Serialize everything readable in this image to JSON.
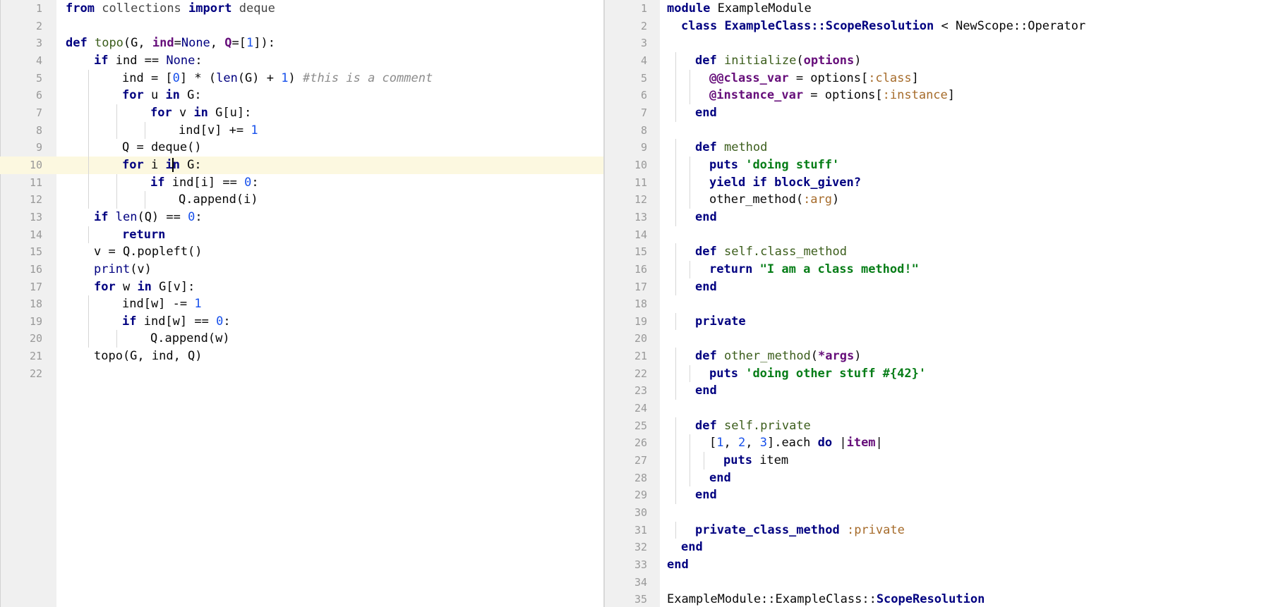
{
  "left_editor": {
    "language": "python",
    "current_line": 10,
    "lines": [
      {
        "n": "1",
        "indent": 0,
        "tokens": [
          [
            "k",
            "from"
          ],
          [
            "p",
            " "
          ],
          [
            "f",
            "collections"
          ],
          [
            "p",
            " "
          ],
          [
            "k",
            "import"
          ],
          [
            "p",
            " "
          ],
          [
            "f",
            "deque"
          ]
        ]
      },
      {
        "n": "2",
        "indent": 0,
        "tokens": []
      },
      {
        "n": "3",
        "indent": 0,
        "tokens": [
          [
            "k",
            "def"
          ],
          [
            "p",
            " "
          ],
          [
            "fn",
            "topo"
          ],
          [
            "p",
            "(G, "
          ],
          [
            "iv",
            "ind"
          ],
          [
            "p",
            "="
          ],
          [
            "bi",
            "None"
          ],
          [
            "p",
            ", "
          ],
          [
            "iv",
            "Q"
          ],
          [
            "p",
            "=["
          ],
          [
            "n",
            "1"
          ],
          [
            "p",
            "]):"
          ]
        ]
      },
      {
        "n": "4",
        "indent": 1,
        "tokens": [
          [
            "k",
            "if"
          ],
          [
            "p",
            " ind == "
          ],
          [
            "bi",
            "None"
          ],
          [
            "p",
            ":"
          ]
        ]
      },
      {
        "n": "5",
        "indent": 2,
        "tokens": [
          [
            "p",
            "ind = ["
          ],
          [
            "n",
            "0"
          ],
          [
            "p",
            "] * ("
          ],
          [
            "bi",
            "len"
          ],
          [
            "p",
            "(G) + "
          ],
          [
            "n",
            "1"
          ],
          [
            "p",
            ") "
          ],
          [
            "c",
            "#this is a comment"
          ]
        ]
      },
      {
        "n": "6",
        "indent": 2,
        "tokens": [
          [
            "k",
            "for"
          ],
          [
            "p",
            " u "
          ],
          [
            "k",
            "in"
          ],
          [
            "p",
            " G:"
          ]
        ]
      },
      {
        "n": "7",
        "indent": 3,
        "tokens": [
          [
            "k",
            "for"
          ],
          [
            "p",
            " v "
          ],
          [
            "k",
            "in"
          ],
          [
            "p",
            " G[u]:"
          ]
        ]
      },
      {
        "n": "8",
        "indent": 4,
        "tokens": [
          [
            "p",
            "ind[v] += "
          ],
          [
            "n",
            "1"
          ]
        ]
      },
      {
        "n": "9",
        "indent": 2,
        "tokens": [
          [
            "p",
            "Q = deque()"
          ]
        ]
      },
      {
        "n": "10",
        "indent": 2,
        "tokens": [
          [
            "k",
            "for"
          ],
          [
            "p",
            " i "
          ],
          [
            "k",
            "i"
          ],
          [
            "cursor",
            ""
          ],
          [
            "k",
            "n"
          ],
          [
            "p",
            " G:"
          ]
        ]
      },
      {
        "n": "11",
        "indent": 3,
        "tokens": [
          [
            "k",
            "if"
          ],
          [
            "p",
            " ind[i] == "
          ],
          [
            "n",
            "0"
          ],
          [
            "p",
            ":"
          ]
        ]
      },
      {
        "n": "12",
        "indent": 4,
        "tokens": [
          [
            "p",
            "Q.append(i)"
          ]
        ]
      },
      {
        "n": "13",
        "indent": 1,
        "tokens": [
          [
            "k",
            "if"
          ],
          [
            "p",
            " "
          ],
          [
            "bi",
            "len"
          ],
          [
            "p",
            "(Q) == "
          ],
          [
            "n",
            "0"
          ],
          [
            "p",
            ":"
          ]
        ]
      },
      {
        "n": "14",
        "indent": 2,
        "tokens": [
          [
            "k",
            "return"
          ]
        ]
      },
      {
        "n": "15",
        "indent": 1,
        "tokens": [
          [
            "p",
            "v = Q.popleft()"
          ]
        ]
      },
      {
        "n": "16",
        "indent": 1,
        "tokens": [
          [
            "bi",
            "print"
          ],
          [
            "p",
            "(v)"
          ]
        ]
      },
      {
        "n": "17",
        "indent": 1,
        "tokens": [
          [
            "k",
            "for"
          ],
          [
            "p",
            " w "
          ],
          [
            "k",
            "in"
          ],
          [
            "p",
            " G[v]:"
          ]
        ]
      },
      {
        "n": "18",
        "indent": 2,
        "tokens": [
          [
            "p",
            "ind[w] -= "
          ],
          [
            "n",
            "1"
          ]
        ]
      },
      {
        "n": "19",
        "indent": 2,
        "tokens": [
          [
            "k",
            "if"
          ],
          [
            "p",
            " ind[w] == "
          ],
          [
            "n",
            "0"
          ],
          [
            "p",
            ":"
          ]
        ]
      },
      {
        "n": "20",
        "indent": 3,
        "tokens": [
          [
            "p",
            "Q.append(w)"
          ]
        ]
      },
      {
        "n": "21",
        "indent": 1,
        "tokens": [
          [
            "p",
            "topo(G, ind, Q)"
          ]
        ]
      },
      {
        "n": "22",
        "indent": 0,
        "tokens": []
      }
    ]
  },
  "right_editor": {
    "language": "ruby",
    "lines": [
      {
        "n": "1",
        "indent": 0,
        "tokens": [
          [
            "k",
            "module"
          ],
          [
            "p",
            " ExampleModule"
          ]
        ]
      },
      {
        "n": "2",
        "indent": 1,
        "tokens": [
          [
            "k",
            "class"
          ],
          [
            "p",
            " "
          ],
          [
            "nm",
            "ExampleClass::ScopeResolution"
          ],
          [
            "p",
            " < NewScope::Operator"
          ]
        ]
      },
      {
        "n": "3",
        "indent": 0,
        "tokens": []
      },
      {
        "n": "4",
        "indent": 2,
        "tokens": [
          [
            "k",
            "def"
          ],
          [
            "p",
            " "
          ],
          [
            "rm",
            "initialize"
          ],
          [
            "p",
            "("
          ],
          [
            "iv",
            "options"
          ],
          [
            "p",
            ")"
          ]
        ]
      },
      {
        "n": "5",
        "indent": 3,
        "tokens": [
          [
            "iv",
            "@@class_var"
          ],
          [
            "p",
            " = options["
          ],
          [
            "sym",
            ":class"
          ],
          [
            "p",
            "]"
          ]
        ]
      },
      {
        "n": "6",
        "indent": 3,
        "tokens": [
          [
            "iv",
            "@instance_var"
          ],
          [
            "p",
            " = options["
          ],
          [
            "sym",
            ":instance"
          ],
          [
            "p",
            "]"
          ]
        ]
      },
      {
        "n": "7",
        "indent": 2,
        "tokens": [
          [
            "k",
            "end"
          ]
        ]
      },
      {
        "n": "8",
        "indent": 0,
        "tokens": []
      },
      {
        "n": "9",
        "indent": 2,
        "tokens": [
          [
            "k",
            "def"
          ],
          [
            "p",
            " "
          ],
          [
            "rm",
            "method"
          ]
        ]
      },
      {
        "n": "10",
        "indent": 3,
        "tokens": [
          [
            "k",
            "puts"
          ],
          [
            "p",
            " "
          ],
          [
            "s",
            "'doing stuff'"
          ]
        ]
      },
      {
        "n": "11",
        "indent": 3,
        "tokens": [
          [
            "k",
            "yield"
          ],
          [
            "p",
            " "
          ],
          [
            "k",
            "if"
          ],
          [
            "p",
            " "
          ],
          [
            "k",
            "block_given?"
          ]
        ]
      },
      {
        "n": "12",
        "indent": 3,
        "tokens": [
          [
            "p",
            "other_method("
          ],
          [
            "sym",
            ":arg"
          ],
          [
            "p",
            ")"
          ]
        ]
      },
      {
        "n": "13",
        "indent": 2,
        "tokens": [
          [
            "k",
            "end"
          ]
        ]
      },
      {
        "n": "14",
        "indent": 0,
        "tokens": []
      },
      {
        "n": "15",
        "indent": 2,
        "tokens": [
          [
            "k",
            "def"
          ],
          [
            "p",
            " "
          ],
          [
            "rm",
            "self.class_method"
          ]
        ]
      },
      {
        "n": "16",
        "indent": 3,
        "tokens": [
          [
            "k",
            "return"
          ],
          [
            "p",
            " "
          ],
          [
            "s",
            "\"I am a class method!\""
          ]
        ]
      },
      {
        "n": "17",
        "indent": 2,
        "tokens": [
          [
            "k",
            "end"
          ]
        ]
      },
      {
        "n": "18",
        "indent": 0,
        "tokens": []
      },
      {
        "n": "19",
        "indent": 2,
        "tokens": [
          [
            "k",
            "private"
          ]
        ]
      },
      {
        "n": "20",
        "indent": 0,
        "tokens": []
      },
      {
        "n": "21",
        "indent": 2,
        "tokens": [
          [
            "k",
            "def"
          ],
          [
            "p",
            " "
          ],
          [
            "rm",
            "other_method"
          ],
          [
            "p",
            "("
          ],
          [
            "iv",
            "*args"
          ],
          [
            "p",
            ")"
          ]
        ]
      },
      {
        "n": "22",
        "indent": 3,
        "tokens": [
          [
            "k",
            "puts"
          ],
          [
            "p",
            " "
          ],
          [
            "s",
            "'doing other stuff #{42}'"
          ]
        ]
      },
      {
        "n": "23",
        "indent": 2,
        "tokens": [
          [
            "k",
            "end"
          ]
        ]
      },
      {
        "n": "24",
        "indent": 0,
        "tokens": []
      },
      {
        "n": "25",
        "indent": 2,
        "tokens": [
          [
            "k",
            "def"
          ],
          [
            "p",
            " "
          ],
          [
            "rm",
            "self.private"
          ]
        ]
      },
      {
        "n": "26",
        "indent": 3,
        "tokens": [
          [
            "p",
            "["
          ],
          [
            "n",
            "1"
          ],
          [
            "p",
            ", "
          ],
          [
            "n",
            "2"
          ],
          [
            "p",
            ", "
          ],
          [
            "n",
            "3"
          ],
          [
            "p",
            "].each "
          ],
          [
            "k",
            "do"
          ],
          [
            "p",
            " |"
          ],
          [
            "iv",
            "item"
          ],
          [
            "p",
            "|"
          ]
        ]
      },
      {
        "n": "27",
        "indent": 4,
        "tokens": [
          [
            "k",
            "puts"
          ],
          [
            "p",
            " item"
          ]
        ]
      },
      {
        "n": "28",
        "indent": 3,
        "tokens": [
          [
            "k",
            "end"
          ]
        ]
      },
      {
        "n": "29",
        "indent": 2,
        "tokens": [
          [
            "k",
            "end"
          ]
        ]
      },
      {
        "n": "30",
        "indent": 0,
        "tokens": []
      },
      {
        "n": "31",
        "indent": 2,
        "tokens": [
          [
            "k",
            "private_class_method"
          ],
          [
            "p",
            " "
          ],
          [
            "sym",
            ":private"
          ]
        ]
      },
      {
        "n": "32",
        "indent": 1,
        "tokens": [
          [
            "k",
            "end"
          ]
        ]
      },
      {
        "n": "33",
        "indent": 0,
        "tokens": [
          [
            "k",
            "end"
          ]
        ]
      },
      {
        "n": "34",
        "indent": 0,
        "tokens": []
      },
      {
        "n": "35",
        "indent": 0,
        "tokens": [
          [
            "p",
            "ExampleModule::ExampleClass::"
          ],
          [
            "nm",
            "ScopeResolution"
          ]
        ]
      }
    ]
  },
  "colors": {
    "keyword": "#000080",
    "number": "#1750eb",
    "string": "#067d17",
    "symbol": "#a66b2a",
    "comment": "#8c8c8c",
    "current_line": "#fcf8e0",
    "gutter": "#f0f0f0"
  }
}
